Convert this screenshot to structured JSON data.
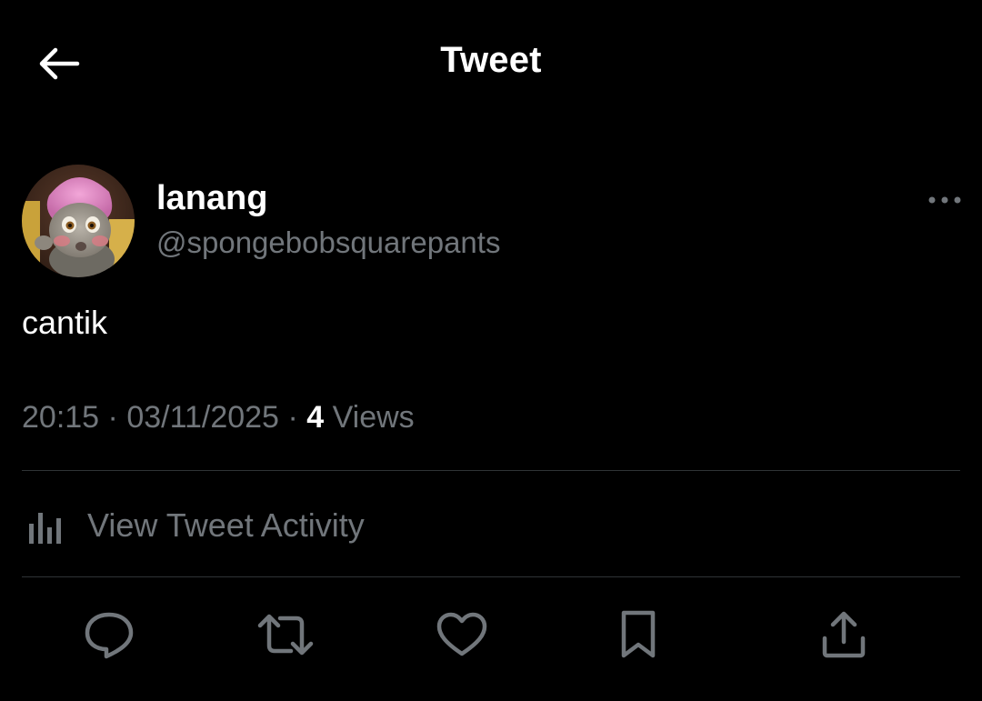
{
  "header": {
    "title": "Tweet",
    "back_icon": "arrow-left-icon"
  },
  "author": {
    "display_name": "lanang",
    "handle": "@spongebobsquarepants",
    "avatar_description_icon": "avatar-image"
  },
  "tweet": {
    "text": "cantik",
    "time": "20:15",
    "date": "03/11/2025",
    "views_count": "4",
    "views_label": "Views"
  },
  "activity": {
    "label": "View Tweet Activity",
    "icon": "bar-chart-icon"
  },
  "actions": [
    {
      "name": "reply",
      "icon": "comment-icon"
    },
    {
      "name": "retweet",
      "icon": "retweet-icon"
    },
    {
      "name": "like",
      "icon": "heart-icon"
    },
    {
      "name": "bookmark",
      "icon": "bookmark-icon"
    },
    {
      "name": "share",
      "icon": "share-icon"
    }
  ],
  "colors": {
    "background": "#000000",
    "primary_text": "#ffffff",
    "secondary_text": "#71767b",
    "divider": "#2f3336"
  }
}
